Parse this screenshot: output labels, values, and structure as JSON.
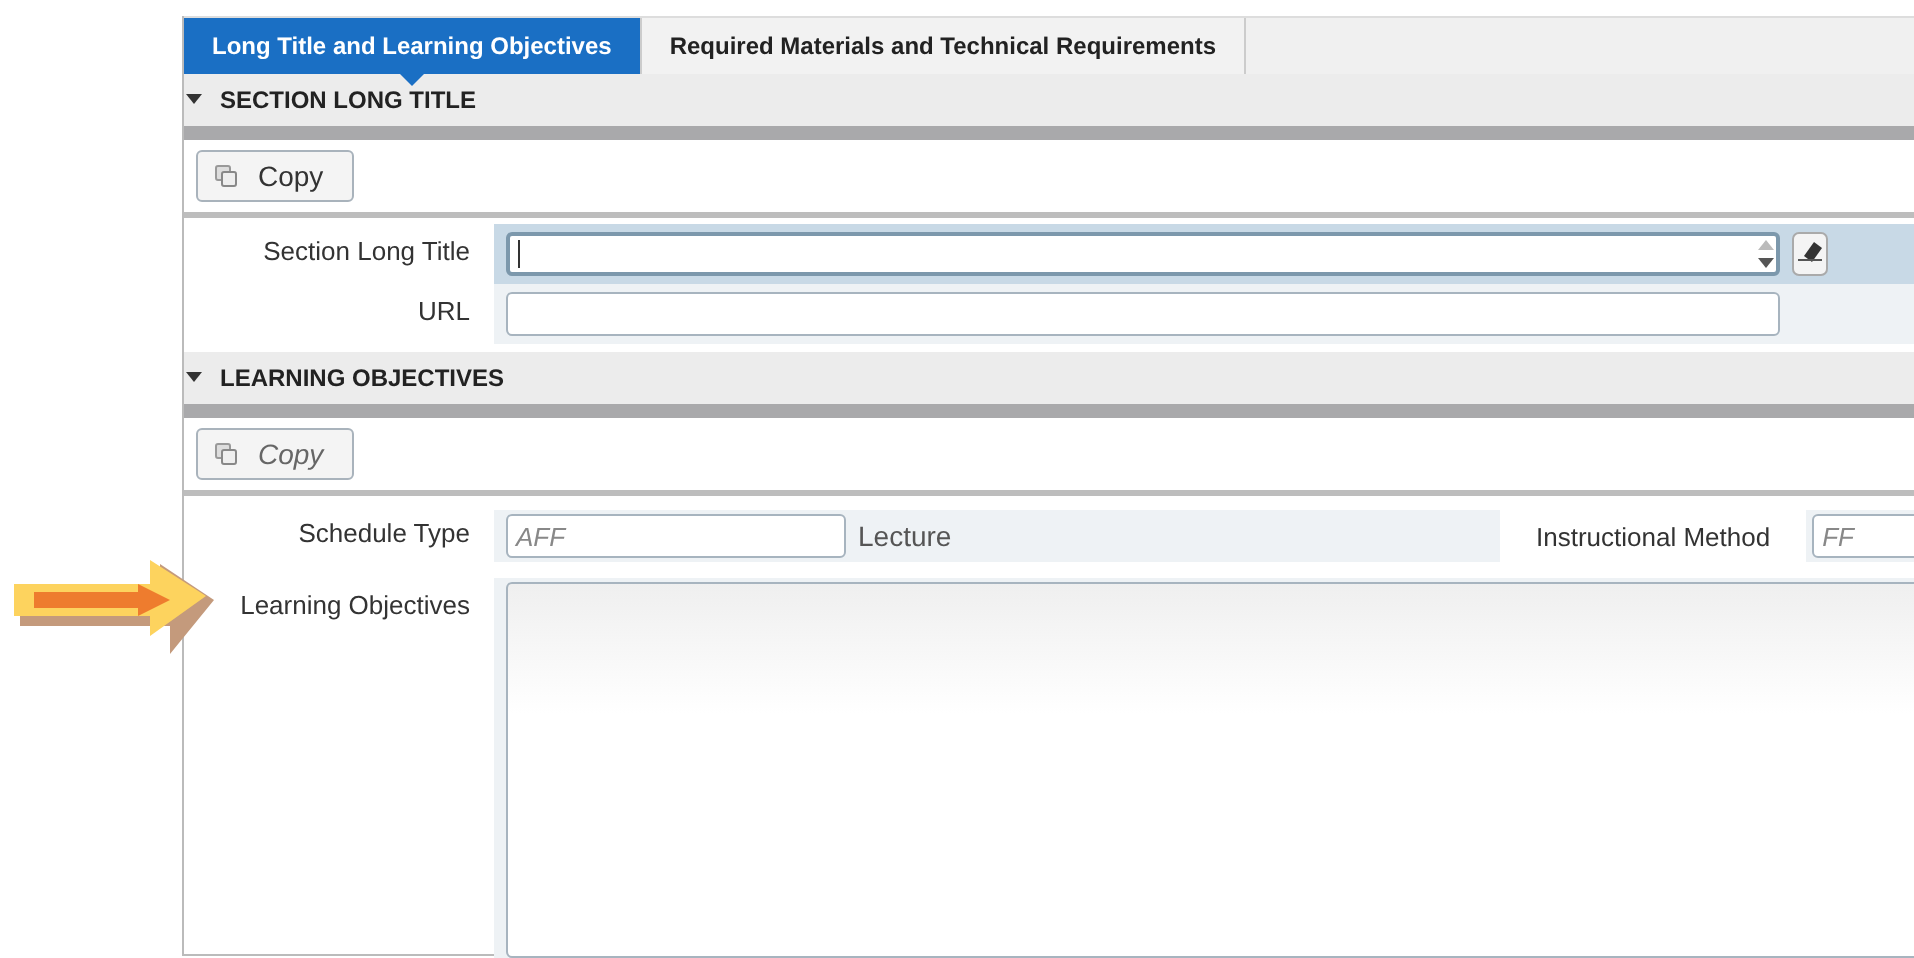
{
  "tabs": [
    {
      "label": "Long Title and Learning Objectives",
      "selected": true
    },
    {
      "label": "Required Materials and Technical Requirements",
      "selected": false
    }
  ],
  "sections": [
    {
      "title": "SECTION LONG TITLE",
      "expanded": true,
      "copy": {
        "label": "Copy",
        "disabled": false
      },
      "fields": [
        {
          "kind": "long_text",
          "label": "Section Long Title",
          "focused": true
        },
        {
          "kind": "text",
          "label": "URL",
          "focused": false
        }
      ]
    },
    {
      "title": "LEARNING OBJECTIVES",
      "expanded": true,
      "copy": {
        "label": "Copy",
        "disabled": true
      },
      "fields": [
        {
          "kind": "code",
          "label": "Schedule Type",
          "value": "AFF",
          "description": "Lecture",
          "extra_label": "Instructional Method",
          "extra_value": "FF"
        },
        {
          "kind": "textarea",
          "label": "Learning Objectives",
          "focused": false
        }
      ]
    }
  ]
}
